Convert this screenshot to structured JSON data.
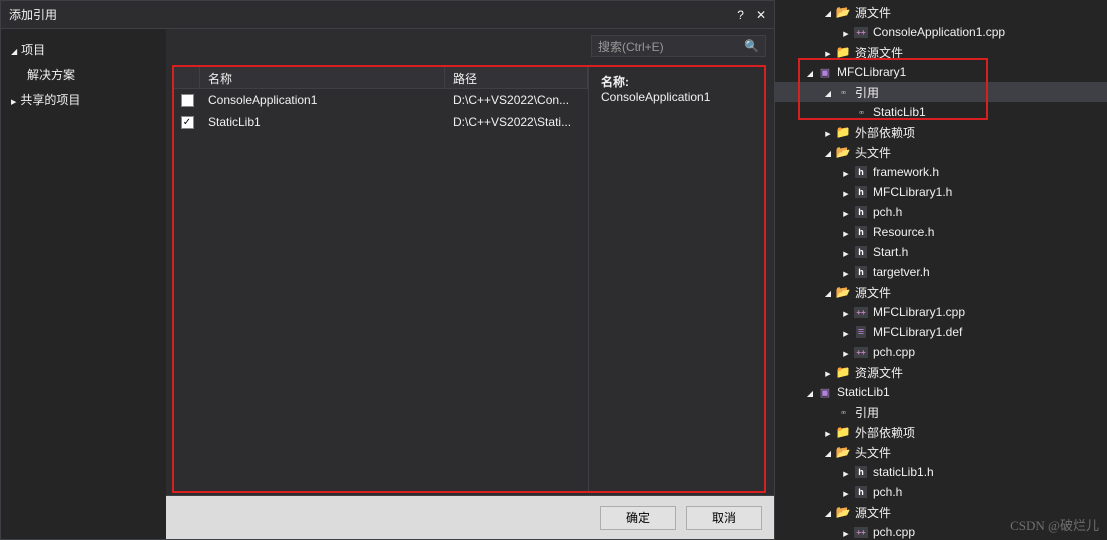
{
  "dialog": {
    "title": "添加引用",
    "help": "?",
    "close": "✕",
    "sidebar_header": "项目",
    "sidebar_items": [
      "解决方案",
      "共享的项目"
    ],
    "search_placeholder": "搜索(Ctrl+E)",
    "columns": {
      "name": "名称",
      "path": "路径"
    },
    "rows": [
      {
        "checked": false,
        "name": "ConsoleApplication1",
        "path": "D:\\C++VS2022\\Con..."
      },
      {
        "checked": true,
        "name": "StaticLib1",
        "path": "D:\\C++VS2022\\Stati..."
      }
    ],
    "detail_label": "名称:",
    "detail_value": "ConsoleApplication1",
    "ok": "确定",
    "cancel": "取消"
  },
  "tree": [
    {
      "depth": 0,
      "exp": "open",
      "icon": "folder-open-ico",
      "label": "源文件"
    },
    {
      "depth": 1,
      "exp": "closed",
      "icon": "cpp-ico",
      "label": "ConsoleApplication1.cpp"
    },
    {
      "depth": 0,
      "exp": "closed",
      "icon": "folder-ico",
      "label": "资源文件"
    },
    {
      "depth": -1,
      "exp": "open",
      "icon": "proj-ico",
      "label": "MFCLibrary1"
    },
    {
      "depth": 0,
      "exp": "open",
      "icon": "ref-ico",
      "label": "引用",
      "sel": true
    },
    {
      "depth": 1,
      "exp": "none",
      "icon": "ref-ico",
      "label": "StaticLib1"
    },
    {
      "depth": 0,
      "exp": "closed",
      "icon": "folder-ico",
      "label": "外部依赖项"
    },
    {
      "depth": 0,
      "exp": "open",
      "icon": "folder-open-ico",
      "label": "头文件"
    },
    {
      "depth": 1,
      "exp": "closed",
      "icon": "h-ico",
      "label": "framework.h"
    },
    {
      "depth": 1,
      "exp": "closed",
      "icon": "h-ico",
      "label": "MFCLibrary1.h"
    },
    {
      "depth": 1,
      "exp": "closed",
      "icon": "h-ico",
      "label": "pch.h"
    },
    {
      "depth": 1,
      "exp": "closed",
      "icon": "h-ico",
      "label": "Resource.h"
    },
    {
      "depth": 1,
      "exp": "closed",
      "icon": "h-ico",
      "label": "Start.h"
    },
    {
      "depth": 1,
      "exp": "closed",
      "icon": "h-ico",
      "label": "targetver.h"
    },
    {
      "depth": 0,
      "exp": "open",
      "icon": "folder-open-ico",
      "label": "源文件"
    },
    {
      "depth": 1,
      "exp": "closed",
      "icon": "cpp-ico",
      "label": "MFCLibrary1.cpp"
    },
    {
      "depth": 1,
      "exp": "closed",
      "icon": "def-ico",
      "label": "MFCLibrary1.def"
    },
    {
      "depth": 1,
      "exp": "closed",
      "icon": "cpp-ico",
      "label": "pch.cpp"
    },
    {
      "depth": 0,
      "exp": "closed",
      "icon": "folder-ico",
      "label": "资源文件"
    },
    {
      "depth": -1,
      "exp": "open",
      "icon": "proj-ico",
      "label": "StaticLib1"
    },
    {
      "depth": 0,
      "exp": "none",
      "icon": "ref-ico",
      "label": "引用"
    },
    {
      "depth": 0,
      "exp": "closed",
      "icon": "folder-ico",
      "label": "外部依赖项"
    },
    {
      "depth": 0,
      "exp": "open",
      "icon": "folder-open-ico",
      "label": "头文件"
    },
    {
      "depth": 1,
      "exp": "closed",
      "icon": "h-ico",
      "label": "staticLib1.h"
    },
    {
      "depth": 1,
      "exp": "closed",
      "icon": "h-ico",
      "label": "pch.h"
    },
    {
      "depth": 0,
      "exp": "open",
      "icon": "folder-open-ico",
      "label": "源文件"
    },
    {
      "depth": 1,
      "exp": "closed",
      "icon": "cpp-ico",
      "label": "pch.cpp"
    }
  ],
  "watermark": "CSDN @破烂儿"
}
